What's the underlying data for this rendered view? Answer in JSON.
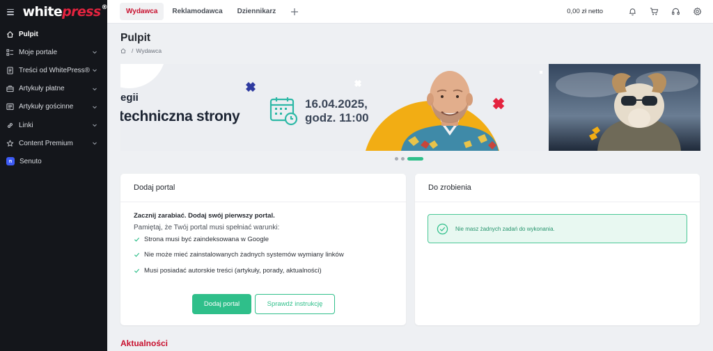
{
  "brand": {
    "logo_part1": "white",
    "logo_part2": "press",
    "logo_mark": "®",
    "accent": "#c8102e",
    "green": "#2fbf8a"
  },
  "sidebar": {
    "items": [
      {
        "label": "Pulpit",
        "icon": "home-icon",
        "active": true,
        "has_children": false
      },
      {
        "label": "Moje portale",
        "icon": "grid-list-icon",
        "active": false,
        "has_children": true
      },
      {
        "label": "Treści od WhitePress®",
        "icon": "document-icon",
        "active": false,
        "has_children": true
      },
      {
        "label": "Artykuły płatne",
        "icon": "briefcase-icon",
        "active": false,
        "has_children": true
      },
      {
        "label": "Artykuły gościnne",
        "icon": "newspaper-icon",
        "active": false,
        "has_children": true
      },
      {
        "label": "Linki",
        "icon": "link-icon",
        "active": false,
        "has_children": true
      },
      {
        "label": "Content Premium",
        "icon": "star-icon",
        "active": false,
        "has_children": true
      },
      {
        "label": "Senuto",
        "icon": "senuto-logo-icon",
        "active": false,
        "has_children": false
      }
    ]
  },
  "topbar": {
    "tabs": [
      {
        "label": "Wydawca",
        "active": true
      },
      {
        "label": "Reklamodawca",
        "active": false
      },
      {
        "label": "Dziennikarz",
        "active": false
      }
    ],
    "balance": "0,00 zł netto"
  },
  "page": {
    "title": "Pulpit",
    "breadcrumb": "Wydawca"
  },
  "banner": {
    "line1": "egii",
    "line2": "techniczna strony",
    "date": "16.04.2025,",
    "time": "godz. 11:00"
  },
  "carousel": {
    "slides": 3,
    "active": 3
  },
  "add_portal": {
    "title": "Dodaj portal",
    "lead": "Zacznij zarabiać. Dodaj swój pierwszy portal.",
    "sub": "Pamiętaj, że Twój portal musi spełniać warunki:",
    "requirements": [
      "Strona musi być zaindeksowana w Google",
      "Nie może mieć zainstalowanych żadnych systemów wymiany linków",
      "Musi posiadać autorskie treści (artykuły, porady, aktualności)"
    ],
    "primary_button": "Dodaj portal",
    "secondary_button": "Sprawdź instrukcję"
  },
  "todo": {
    "title": "Do zrobienia",
    "message": "Nie masz żadnych zadań do wykonania."
  },
  "news": {
    "title": "Aktualności"
  }
}
